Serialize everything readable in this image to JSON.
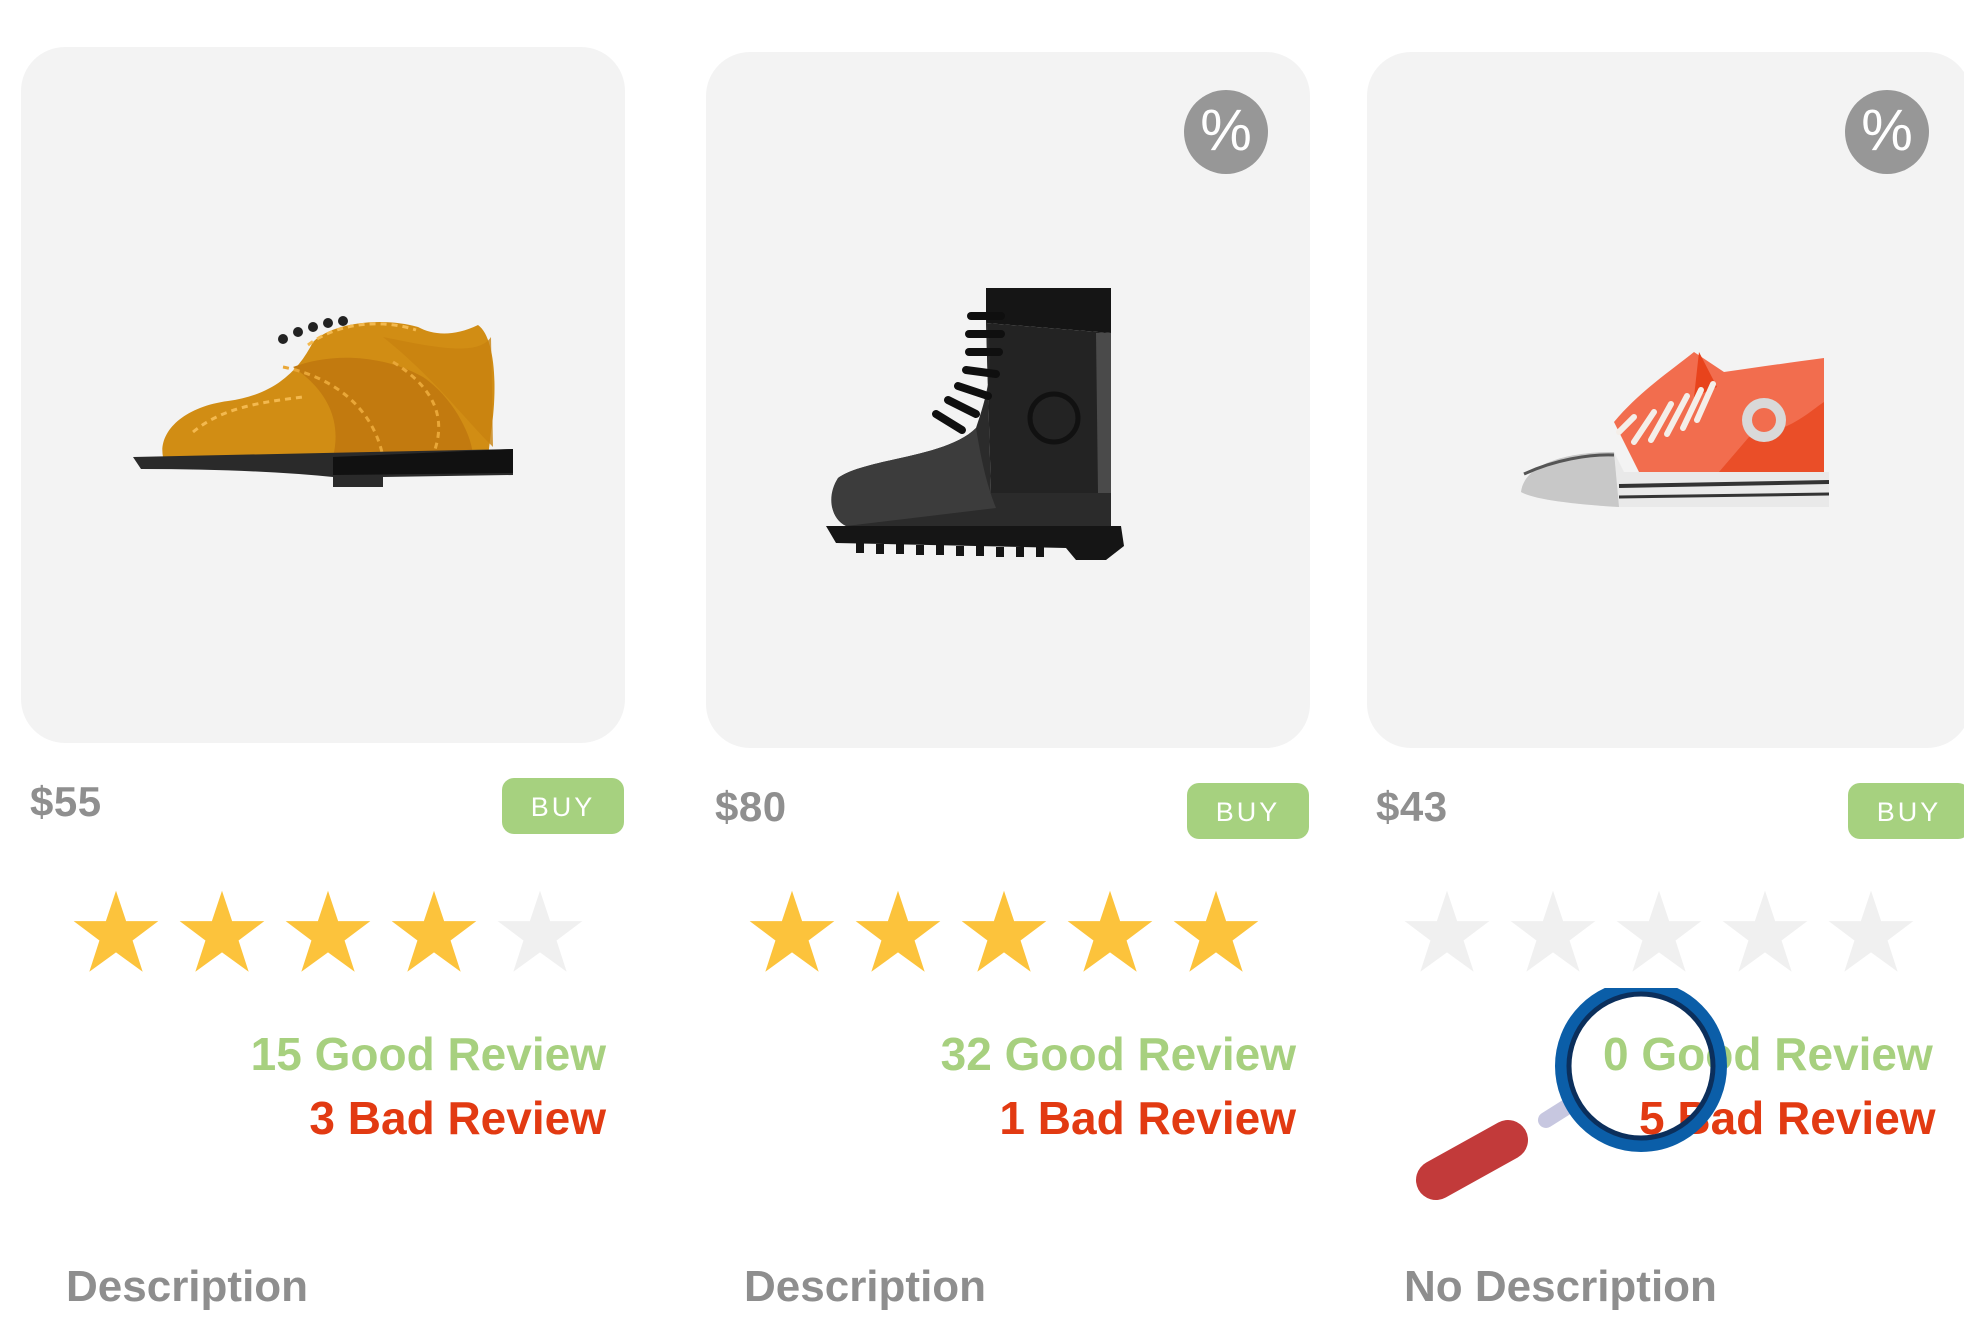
{
  "colors": {
    "card_background": "#f3f3f3",
    "badge": "#979797",
    "price_text": "#8f8f8f",
    "buy_button": "#a6d17f",
    "star_filled": "#fcc33c",
    "star_empty": "#f0f0f0",
    "good_review": "#a7d07f",
    "bad_review": "#e23a12",
    "description_text": "#8e8e8e"
  },
  "products": [
    {
      "image_icon": "brogue-shoe-icon",
      "discount_badge": "",
      "price": "$55",
      "buy_label": "BUY",
      "rating": 4,
      "rating_max": 5,
      "good_reviews": "15 Good Review",
      "bad_reviews": "3 Bad Review",
      "description": "Description"
    },
    {
      "image_icon": "combat-boot-icon",
      "discount_badge": "%",
      "price": "$80",
      "buy_label": "BUY",
      "rating": 5,
      "rating_max": 5,
      "good_reviews": "32 Good Review",
      "bad_reviews": "1 Bad Review",
      "description": "Description"
    },
    {
      "image_icon": "high-top-sneaker-icon",
      "discount_badge": "%",
      "price": "$43",
      "buy_label": "BUY",
      "rating": 0,
      "rating_max": 5,
      "good_reviews": "0 Good Review",
      "bad_reviews": "5 Bad Review",
      "description": "No Description"
    }
  ],
  "overlay_icon": "magnifying-glass-icon"
}
